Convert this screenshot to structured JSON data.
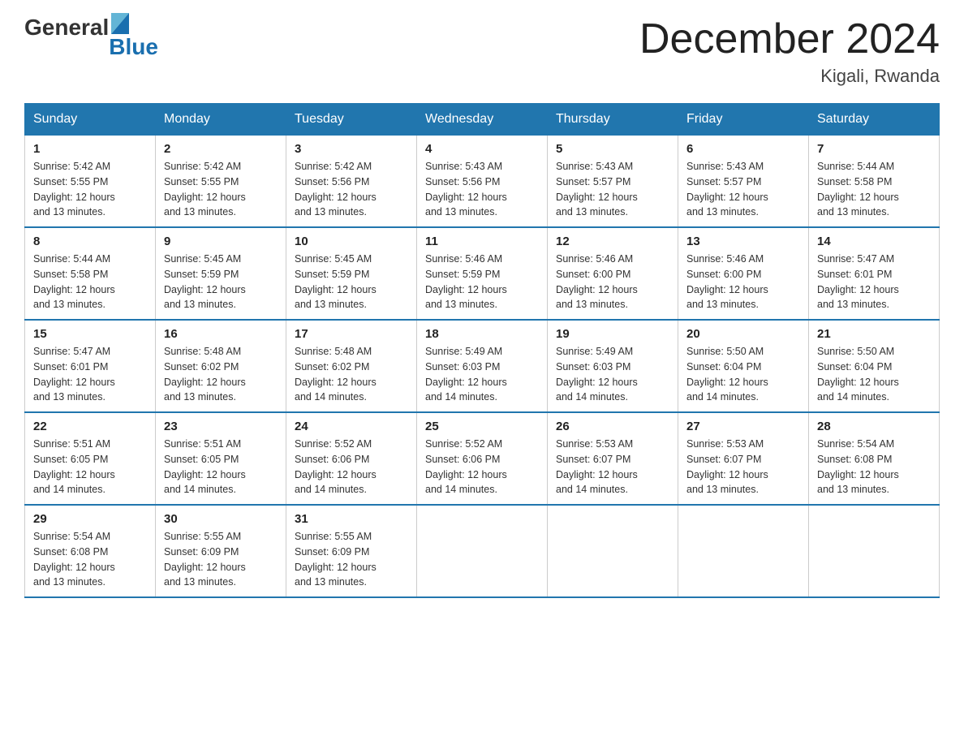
{
  "header": {
    "logo": {
      "text1": "General",
      "text2": "Blue"
    },
    "month": "December 2024",
    "location": "Kigali, Rwanda"
  },
  "days_of_week": [
    "Sunday",
    "Monday",
    "Tuesday",
    "Wednesday",
    "Thursday",
    "Friday",
    "Saturday"
  ],
  "weeks": [
    [
      {
        "day": "1",
        "sunrise": "5:42 AM",
        "sunset": "5:55 PM",
        "daylight": "12 hours and 13 minutes."
      },
      {
        "day": "2",
        "sunrise": "5:42 AM",
        "sunset": "5:55 PM",
        "daylight": "12 hours and 13 minutes."
      },
      {
        "day": "3",
        "sunrise": "5:42 AM",
        "sunset": "5:56 PM",
        "daylight": "12 hours and 13 minutes."
      },
      {
        "day": "4",
        "sunrise": "5:43 AM",
        "sunset": "5:56 PM",
        "daylight": "12 hours and 13 minutes."
      },
      {
        "day": "5",
        "sunrise": "5:43 AM",
        "sunset": "5:57 PM",
        "daylight": "12 hours and 13 minutes."
      },
      {
        "day": "6",
        "sunrise": "5:43 AM",
        "sunset": "5:57 PM",
        "daylight": "12 hours and 13 minutes."
      },
      {
        "day": "7",
        "sunrise": "5:44 AM",
        "sunset": "5:58 PM",
        "daylight": "12 hours and 13 minutes."
      }
    ],
    [
      {
        "day": "8",
        "sunrise": "5:44 AM",
        "sunset": "5:58 PM",
        "daylight": "12 hours and 13 minutes."
      },
      {
        "day": "9",
        "sunrise": "5:45 AM",
        "sunset": "5:59 PM",
        "daylight": "12 hours and 13 minutes."
      },
      {
        "day": "10",
        "sunrise": "5:45 AM",
        "sunset": "5:59 PM",
        "daylight": "12 hours and 13 minutes."
      },
      {
        "day": "11",
        "sunrise": "5:46 AM",
        "sunset": "5:59 PM",
        "daylight": "12 hours and 13 minutes."
      },
      {
        "day": "12",
        "sunrise": "5:46 AM",
        "sunset": "6:00 PM",
        "daylight": "12 hours and 13 minutes."
      },
      {
        "day": "13",
        "sunrise": "5:46 AM",
        "sunset": "6:00 PM",
        "daylight": "12 hours and 13 minutes."
      },
      {
        "day": "14",
        "sunrise": "5:47 AM",
        "sunset": "6:01 PM",
        "daylight": "12 hours and 13 minutes."
      }
    ],
    [
      {
        "day": "15",
        "sunrise": "5:47 AM",
        "sunset": "6:01 PM",
        "daylight": "12 hours and 13 minutes."
      },
      {
        "day": "16",
        "sunrise": "5:48 AM",
        "sunset": "6:02 PM",
        "daylight": "12 hours and 13 minutes."
      },
      {
        "day": "17",
        "sunrise": "5:48 AM",
        "sunset": "6:02 PM",
        "daylight": "12 hours and 14 minutes."
      },
      {
        "day": "18",
        "sunrise": "5:49 AM",
        "sunset": "6:03 PM",
        "daylight": "12 hours and 14 minutes."
      },
      {
        "day": "19",
        "sunrise": "5:49 AM",
        "sunset": "6:03 PM",
        "daylight": "12 hours and 14 minutes."
      },
      {
        "day": "20",
        "sunrise": "5:50 AM",
        "sunset": "6:04 PM",
        "daylight": "12 hours and 14 minutes."
      },
      {
        "day": "21",
        "sunrise": "5:50 AM",
        "sunset": "6:04 PM",
        "daylight": "12 hours and 14 minutes."
      }
    ],
    [
      {
        "day": "22",
        "sunrise": "5:51 AM",
        "sunset": "6:05 PM",
        "daylight": "12 hours and 14 minutes."
      },
      {
        "day": "23",
        "sunrise": "5:51 AM",
        "sunset": "6:05 PM",
        "daylight": "12 hours and 14 minutes."
      },
      {
        "day": "24",
        "sunrise": "5:52 AM",
        "sunset": "6:06 PM",
        "daylight": "12 hours and 14 minutes."
      },
      {
        "day": "25",
        "sunrise": "5:52 AM",
        "sunset": "6:06 PM",
        "daylight": "12 hours and 14 minutes."
      },
      {
        "day": "26",
        "sunrise": "5:53 AM",
        "sunset": "6:07 PM",
        "daylight": "12 hours and 14 minutes."
      },
      {
        "day": "27",
        "sunrise": "5:53 AM",
        "sunset": "6:07 PM",
        "daylight": "12 hours and 13 minutes."
      },
      {
        "day": "28",
        "sunrise": "5:54 AM",
        "sunset": "6:08 PM",
        "daylight": "12 hours and 13 minutes."
      }
    ],
    [
      {
        "day": "29",
        "sunrise": "5:54 AM",
        "sunset": "6:08 PM",
        "daylight": "12 hours and 13 minutes."
      },
      {
        "day": "30",
        "sunrise": "5:55 AM",
        "sunset": "6:09 PM",
        "daylight": "12 hours and 13 minutes."
      },
      {
        "day": "31",
        "sunrise": "5:55 AM",
        "sunset": "6:09 PM",
        "daylight": "12 hours and 13 minutes."
      },
      null,
      null,
      null,
      null
    ]
  ],
  "labels": {
    "sunrise": "Sunrise:",
    "sunset": "Sunset:",
    "daylight": "Daylight:"
  }
}
